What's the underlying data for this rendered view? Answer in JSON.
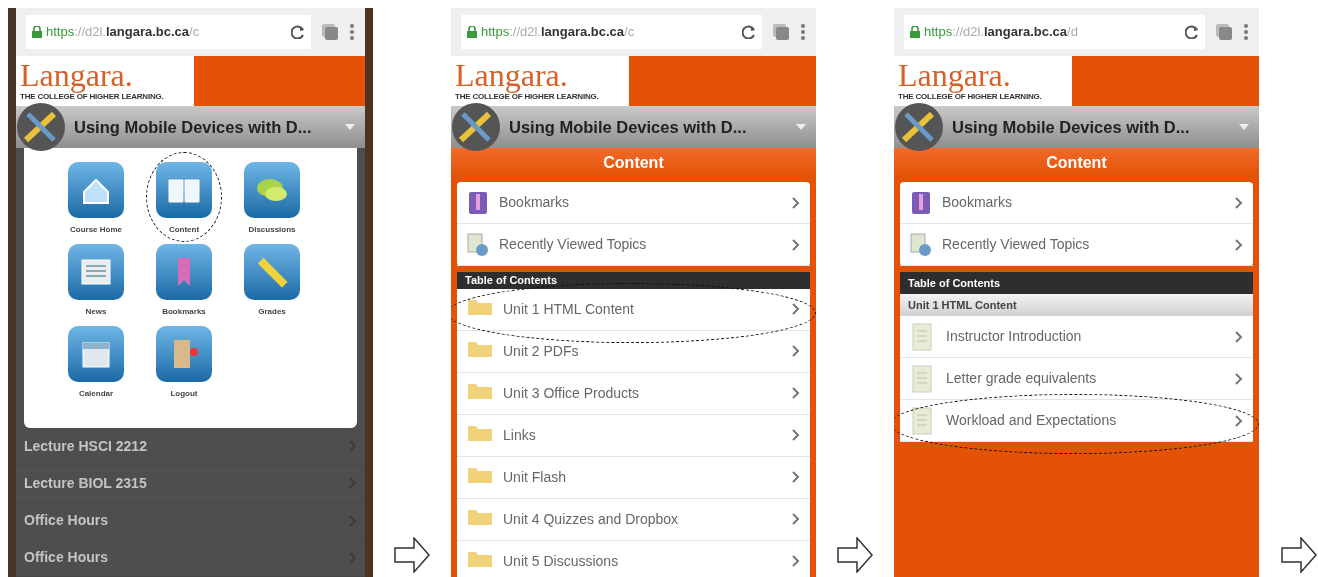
{
  "screens": [
    {
      "kind": "menu",
      "url_scheme": "https",
      "url_path": "://d2l.",
      "url_domain": "langara.bc.ca",
      "url_tail": "/c",
      "logo": "Langara.",
      "tagline": "THE COLLEGE OF HIGHER LEARNING.",
      "course_title": "Using Mobile Devices with D...",
      "tools": [
        {
          "label": "Course Home",
          "circled": false
        },
        {
          "label": "Content",
          "circled": true
        },
        {
          "label": "Discussions",
          "circled": false
        },
        {
          "label": "News",
          "circled": false
        },
        {
          "label": "Bookmarks",
          "circled": false
        },
        {
          "label": "Grades",
          "circled": false
        },
        {
          "label": "Calendar",
          "circled": false
        },
        {
          "label": "Logout",
          "circled": false
        }
      ],
      "background_items": [
        {
          "title": "Lecture HSCI 2212"
        },
        {
          "title": "Lecture BIOL 2315"
        },
        {
          "title": "Office Hours"
        },
        {
          "title": "Office Hours"
        }
      ]
    },
    {
      "kind": "content",
      "url_scheme": "https",
      "url_path": "://d2l.",
      "url_domain": "langara.bc.ca",
      "url_tail": "/c",
      "logo": "Langara.",
      "tagline": "THE COLLEGE OF HIGHER LEARNING.",
      "course_title": "Using Mobile Devices with D...",
      "page_title": "Content",
      "links": [
        {
          "label": "Bookmarks"
        },
        {
          "label": "Recently Viewed Topics"
        }
      ],
      "toc_heading": "Table of Contents",
      "items": [
        {
          "label": "Unit 1 HTML Content",
          "kind": "folder",
          "circled": true
        },
        {
          "label": "Unit 2 PDFs",
          "kind": "folder",
          "circled": false
        },
        {
          "label": "Unit 3 Office Products",
          "kind": "folder",
          "circled": false
        },
        {
          "label": "Links",
          "kind": "folder",
          "circled": false
        },
        {
          "label": "Unit Flash",
          "kind": "folder",
          "circled": false
        },
        {
          "label": "Unit 4 Quizzes and Dropbox",
          "kind": "folder",
          "circled": false
        },
        {
          "label": "Unit 5 Discussions",
          "kind": "folder",
          "circled": false
        }
      ]
    },
    {
      "kind": "content",
      "url_scheme": "https",
      "url_path": "://d2l.",
      "url_domain": "langara.bc.ca",
      "url_tail": "/d",
      "logo": "Langara.",
      "tagline": "THE COLLEGE OF HIGHER LEARNING.",
      "course_title": "Using Mobile Devices with D...",
      "page_title": "Content",
      "links": [
        {
          "label": "Bookmarks"
        },
        {
          "label": "Recently Viewed Topics"
        }
      ],
      "toc_heading": "Table of Contents",
      "toc_subheading": "Unit 1 HTML Content",
      "items": [
        {
          "label": "Instructor Introduction",
          "kind": "topic",
          "circled": false
        },
        {
          "label": "Letter grade equivalents",
          "kind": "topic",
          "circled": false
        },
        {
          "label": "Workload and Expectations",
          "kind": "topic",
          "circled": true
        }
      ]
    }
  ]
}
